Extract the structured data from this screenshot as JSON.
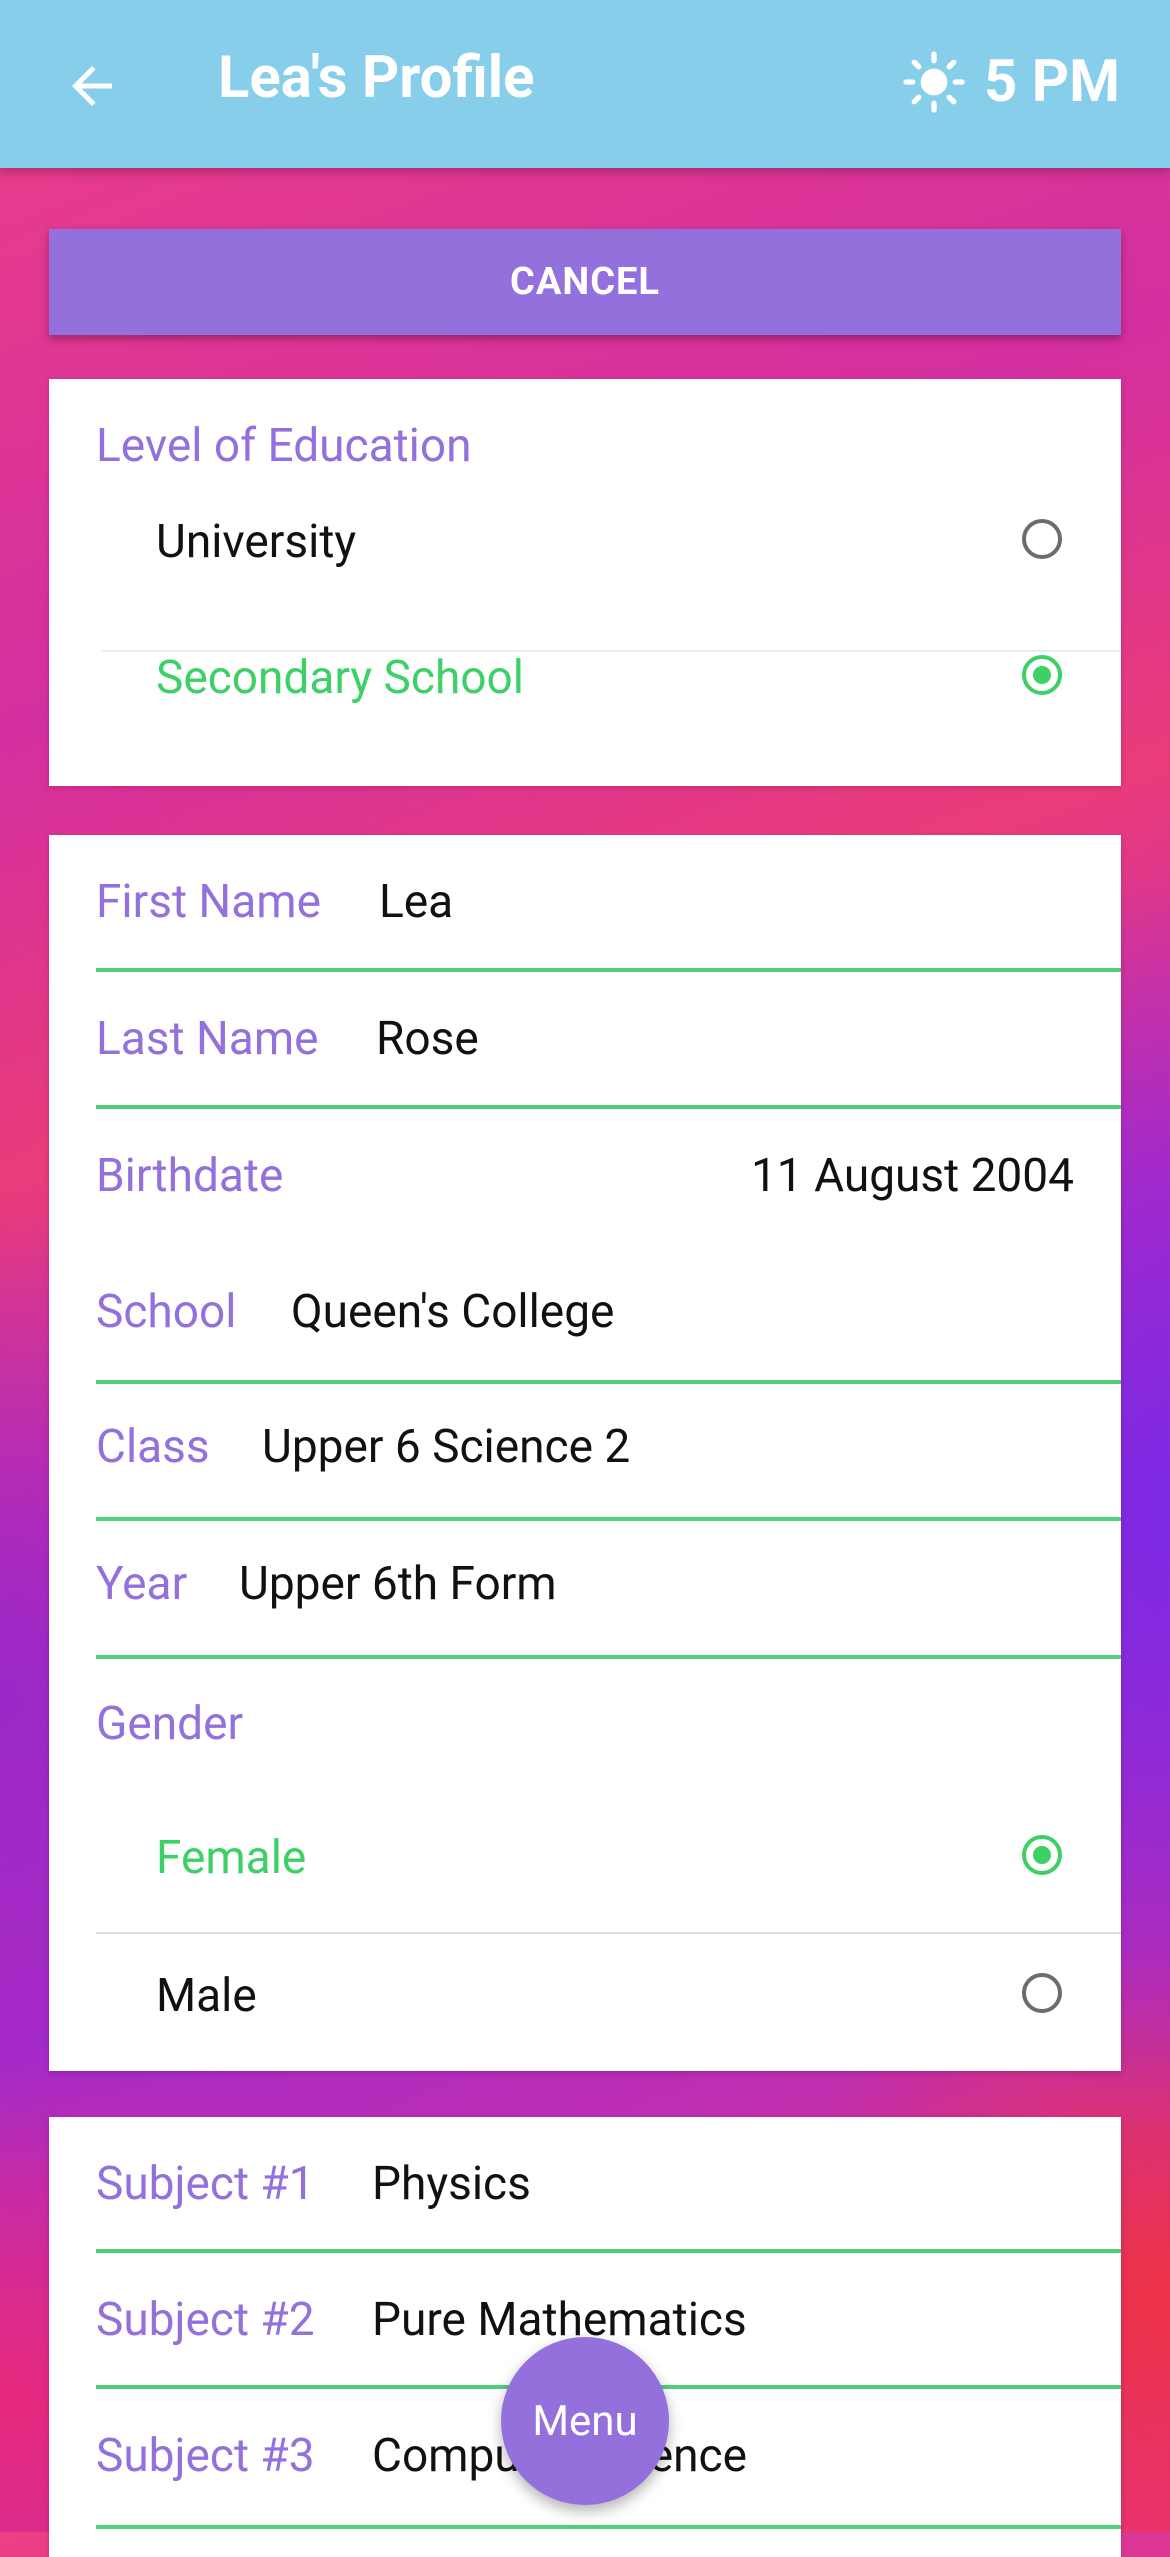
{
  "header": {
    "title": "Lea's Profile",
    "time": "5 PM"
  },
  "cancel_label": "CANCEL",
  "education": {
    "heading": "Level of Education",
    "options": [
      {
        "label": "University",
        "selected": false
      },
      {
        "label": "Secondary School",
        "selected": true
      }
    ]
  },
  "details": {
    "first_name": {
      "label": "First Name",
      "value": "Lea"
    },
    "last_name": {
      "label": "Last Name",
      "value": "Rose"
    },
    "birthdate": {
      "label": "Birthdate",
      "value": "11 August 2004"
    },
    "school": {
      "label": "School",
      "value": "Queen's College"
    },
    "class": {
      "label": "Class",
      "value": "Upper 6 Science 2"
    },
    "year": {
      "label": "Year",
      "value": "Upper 6th Form"
    },
    "gender": {
      "heading": "Gender",
      "options": [
        {
          "label": "Female",
          "selected": true
        },
        {
          "label": "Male",
          "selected": false
        }
      ]
    }
  },
  "subjects": [
    {
      "label": "Subject #1",
      "value": "Physics"
    },
    {
      "label": "Subject #2",
      "value": "Pure Mathematics"
    },
    {
      "label": "Subject #3",
      "value": "Computer Science"
    }
  ],
  "fab_label": "Menu",
  "colors": {
    "appbar": "#87ceeb",
    "accent": "#9470dc",
    "selected_green": "#3dd066"
  }
}
